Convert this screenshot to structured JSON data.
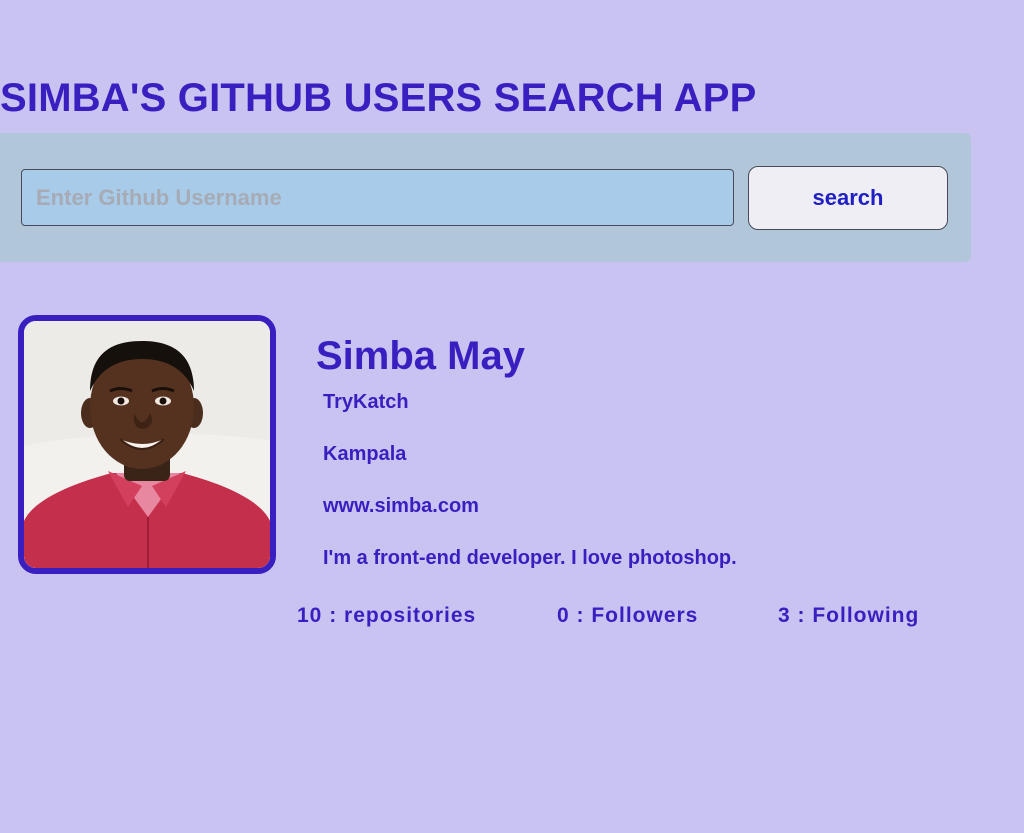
{
  "app": {
    "title": "SIMBA'S GITHUB USERS SEARCH APP"
  },
  "search": {
    "placeholder": "Enter Github Username",
    "value": "",
    "button_label": "search"
  },
  "profile": {
    "name": "Simba May",
    "company": "TryKatch",
    "location": "Kampala",
    "blog": "www.simba.com",
    "bio": "I'm a front-end developer. I love photoshop."
  },
  "stats": {
    "repositories": "10 : repositories",
    "followers": "0 : Followers",
    "following": "3 : Following"
  },
  "colors": {
    "background": "#c9c3f2",
    "accent": "#3a1fc0",
    "panel": "#b1c7d9",
    "input_bg": "#a7cbe9",
    "button_bg": "#efeef4"
  }
}
